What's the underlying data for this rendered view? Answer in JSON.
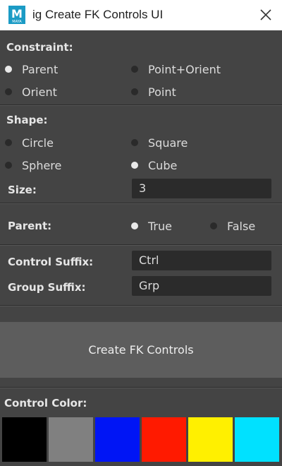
{
  "window": {
    "title": "ig Create FK Controls UI",
    "logo_letter": "M",
    "logo_sub": "MAYA"
  },
  "constraint": {
    "label": "Constraint:",
    "options": [
      "Parent",
      "Point+Orient",
      "Orient",
      "Point"
    ],
    "selected": "Parent"
  },
  "shape": {
    "label": "Shape:",
    "options": [
      "Circle",
      "Square",
      "Sphere",
      "Cube"
    ],
    "selected": "Cube",
    "size_label": "Size:",
    "size_value": "3"
  },
  "parent": {
    "label": "Parent:",
    "options": [
      "True",
      "False"
    ],
    "selected": "True"
  },
  "suffix": {
    "control_label": "Control Suffix:",
    "control_value": "Ctrl",
    "group_label": "Group Suffix:",
    "group_value": "Grp"
  },
  "create_button": "Create FK Controls",
  "color": {
    "label": "Control Color:",
    "swatches": [
      "#000000",
      "#808080",
      "#0015f5",
      "#ff1a00",
      "#fff000",
      "#00e1ff"
    ]
  }
}
